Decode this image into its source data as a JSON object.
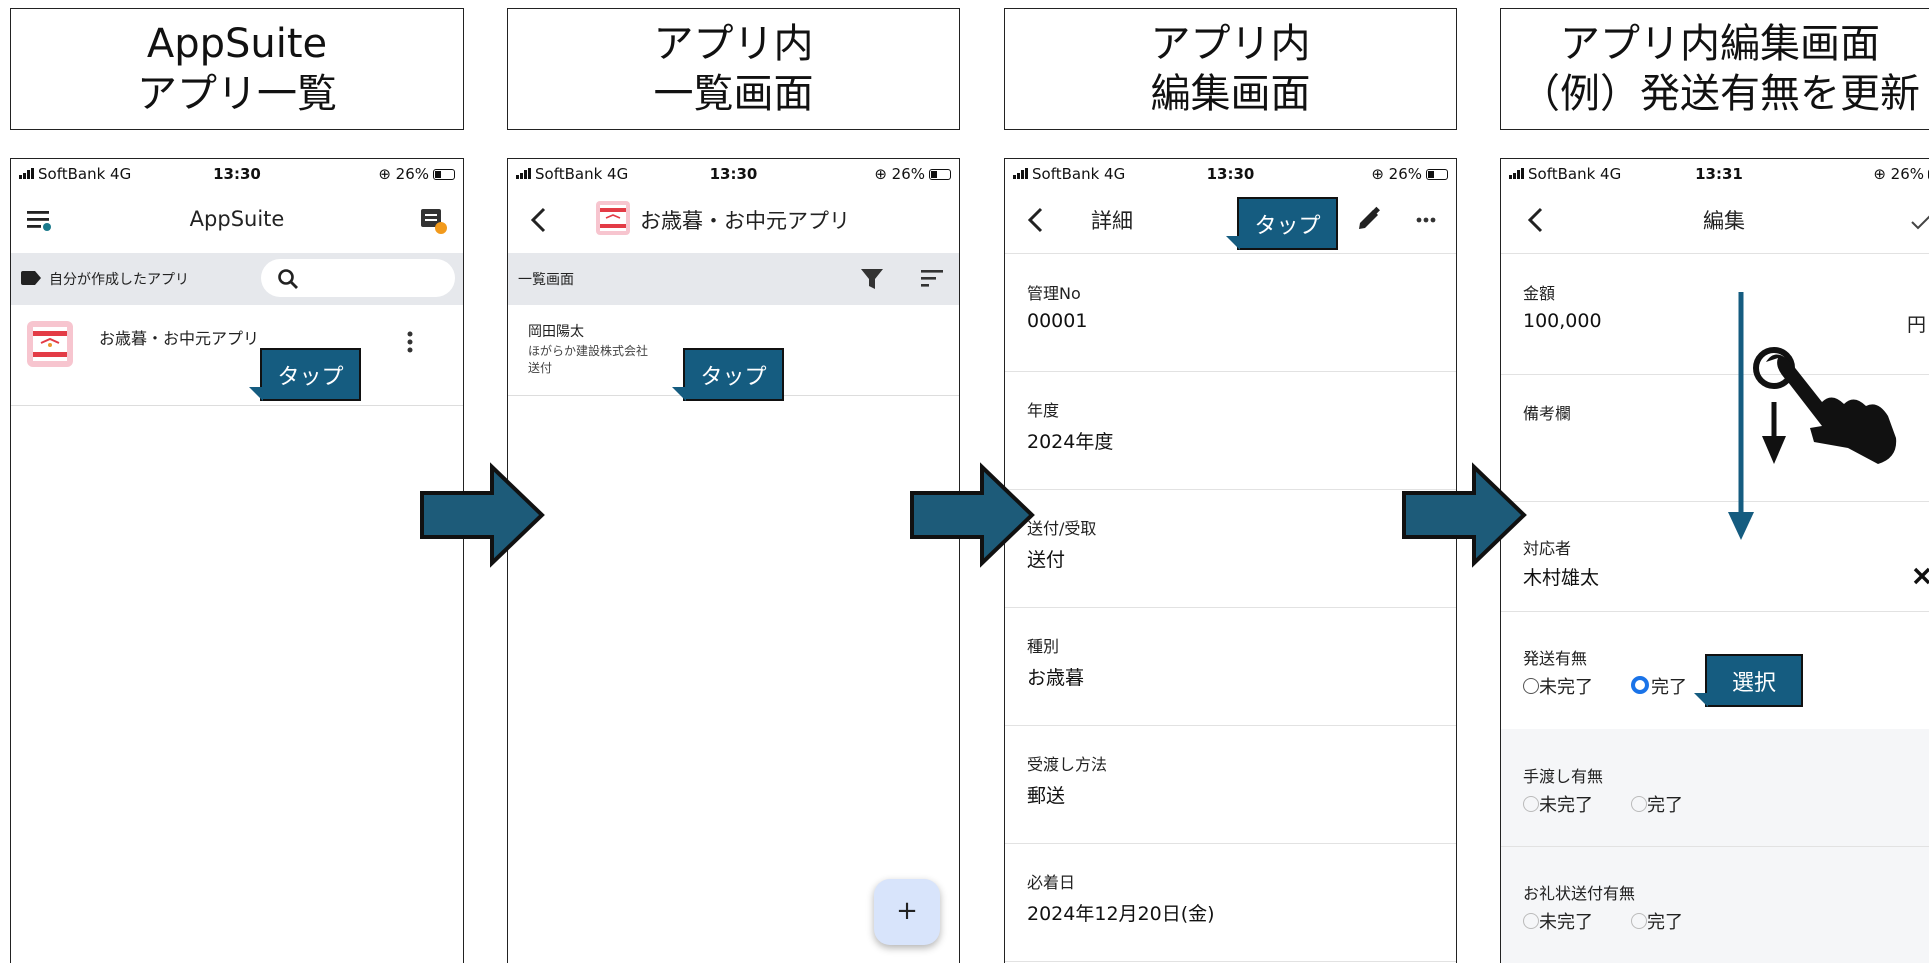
{
  "titles": [
    {
      "line1": "AppSuite",
      "line2": "アプリ一覧"
    },
    {
      "line1": "アプリ内",
      "line2": "一覧画面"
    },
    {
      "line1": "アプリ内",
      "line2": "編集画面"
    },
    {
      "line1": "アプリ内編集画面",
      "line2": "（例）発送有無を更新"
    }
  ],
  "status": {
    "carrier": "SoftBank  4G",
    "times": [
      "13:30",
      "13:30",
      "13:30",
      "13:31"
    ],
    "battery": "26%"
  },
  "screen1": {
    "app_title": "AppSuite",
    "filter_label": "自分が作成したアプリ",
    "app_item": "お歳暮・お中元アプリ",
    "callout": "タップ",
    "icons": [
      "menu-icon",
      "notification-icon",
      "tag-icon",
      "search-icon",
      "more-vert-icon"
    ]
  },
  "screen2": {
    "app_title": "お歳暮・お中元アプリ",
    "view_label": "一覧画面",
    "record": {
      "name": "岡田陽太",
      "company": "ほがらか建設株式会社",
      "type": "送付"
    },
    "callout": "タップ",
    "fab": "+",
    "icons": [
      "back-icon",
      "filter-icon",
      "sort-icon"
    ]
  },
  "screen3": {
    "title": "詳細",
    "callout": "タップ",
    "fields": [
      {
        "label": "管理No",
        "value": "00001"
      },
      {
        "label": "年度",
        "value": "2024年度"
      },
      {
        "label": "送付/受取",
        "value": "送付"
      },
      {
        "label": "種別",
        "value": "お歳暮"
      },
      {
        "label": "受渡し方法",
        "value": "郵送"
      },
      {
        "label": "必着日",
        "value": "2024年12月20日(金)"
      }
    ],
    "icons": [
      "back-icon",
      "edit-icon",
      "more-horiz-icon"
    ]
  },
  "screen4": {
    "title": "編集",
    "amount": {
      "label": "金額",
      "value": "100,000",
      "unit": "円"
    },
    "note": {
      "label": "備考欄"
    },
    "assignee": {
      "label": "対応者",
      "value": "木村雄太"
    },
    "radio_groups": [
      {
        "label": "発送有無",
        "options": [
          "未完了",
          "完了"
        ],
        "selected": 1
      },
      {
        "label": "手渡し有無",
        "options": [
          "未完了",
          "完了"
        ],
        "selected": null
      },
      {
        "label": "お礼状送付有無",
        "options": [
          "未完了",
          "完了"
        ],
        "selected": null
      }
    ],
    "callout": "選択",
    "icons": [
      "back-icon",
      "check-icon",
      "clear-icon",
      "swipe-hand-icon"
    ]
  },
  "colors": {
    "accent": "#155c80",
    "radio": "#1a73e8",
    "gray_bar": "#e6e8ec",
    "fab": "#d8e4fb"
  }
}
